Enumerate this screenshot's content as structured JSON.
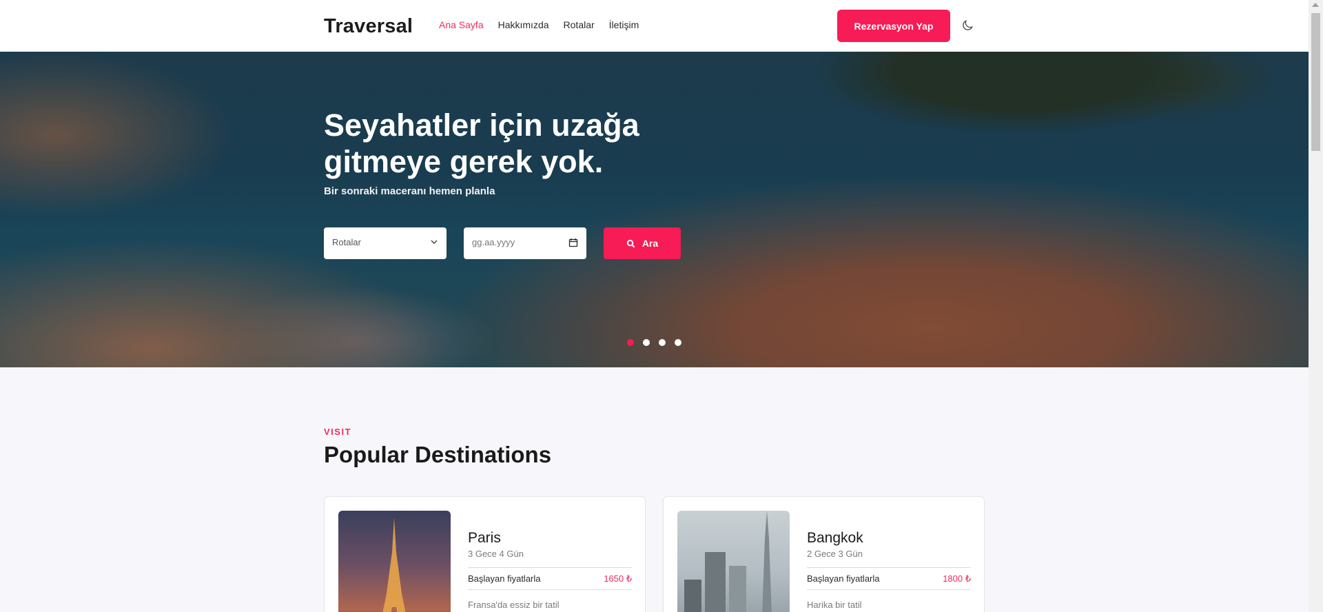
{
  "header": {
    "logo": "Traversal",
    "nav": [
      {
        "label": "Ana Sayfa",
        "active": true
      },
      {
        "label": "Hakkımızda",
        "active": false
      },
      {
        "label": "Rotalar",
        "active": false
      },
      {
        "label": "İletişim",
        "active": false
      }
    ],
    "reserve_label": "Rezervasyon Yap",
    "theme_icon": "moon-icon"
  },
  "hero": {
    "title": "Seyahatler için uzağa gitmeye gerek yok.",
    "subtitle": "Bir sonraki maceranı hemen planla",
    "route_select": "Rotalar",
    "date_placeholder": "gg.aa.yyyy",
    "search_label": "Ara",
    "slides": 4,
    "active_slide": 1
  },
  "section": {
    "eyebrow": "VISIT",
    "title": "Popular Destinations"
  },
  "destinations": [
    {
      "city": "Paris",
      "duration": "3 Gece 4 Gün",
      "price_label": "Başlayan fiyatlarla",
      "price": "1650 ₺",
      "description": "Fransa'da essiz bir tatil"
    },
    {
      "city": "Bangkok",
      "duration": "2 Gece 3 Gün",
      "price_label": "Başlayan fiyatlarla",
      "price": "1800 ₺",
      "description": "Harika bir tatil"
    }
  ],
  "colors": {
    "accent": "#f71b56",
    "accent_text": "#f5295d"
  }
}
